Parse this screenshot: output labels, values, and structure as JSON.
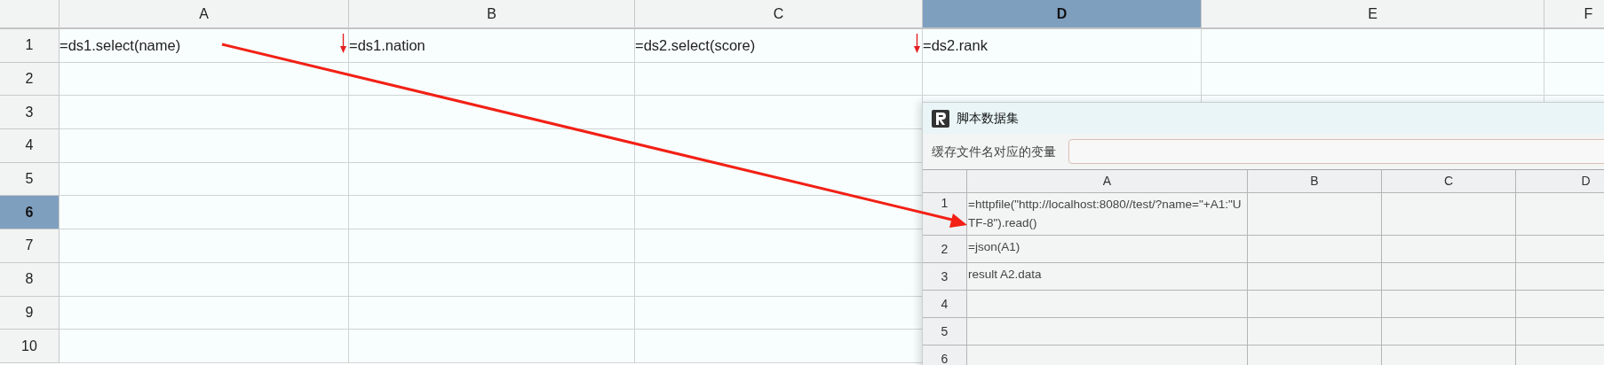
{
  "sheet": {
    "columns": [
      {
        "label": "A",
        "selected": false
      },
      {
        "label": "B",
        "selected": false
      },
      {
        "label": "C",
        "selected": false
      },
      {
        "label": "D",
        "selected": true
      },
      {
        "label": "E",
        "selected": false
      },
      {
        "label": "F",
        "selected": false
      }
    ],
    "rows": [
      {
        "label": "1",
        "selected": false,
        "cells": [
          {
            "text": "=ds1.select(name)",
            "expand_down": true
          },
          {
            "text": "=ds1.nation",
            "expand_down": false
          },
          {
            "text": "=ds2.select(score)",
            "expand_down": true
          },
          {
            "text": "=ds2.rank",
            "expand_down": false
          }
        ]
      },
      {
        "label": "2",
        "selected": false
      },
      {
        "label": "3",
        "selected": false
      },
      {
        "label": "4",
        "selected": false
      },
      {
        "label": "5",
        "selected": false
      },
      {
        "label": "6",
        "selected": true
      },
      {
        "label": "7",
        "selected": false
      },
      {
        "label": "8",
        "selected": false
      },
      {
        "label": "9",
        "selected": false
      },
      {
        "label": "10",
        "selected": false
      }
    ]
  },
  "dialog": {
    "title": "脚本数据集",
    "field_label": "缓存文件名对应的变量",
    "grid": {
      "columns": [
        "A",
        "B",
        "C",
        "D"
      ],
      "rows": [
        {
          "label": "1",
          "cells": [
            "=httpfile(\"http://localhost:8080//test/?name=\"+A1:\"UTF-8\").read()"
          ]
        },
        {
          "label": "2",
          "cells": [
            "=json(A1)"
          ]
        },
        {
          "label": "3",
          "cells": [
            "result A2.data"
          ]
        },
        {
          "label": "4"
        },
        {
          "label": "5"
        },
        {
          "label": "6"
        }
      ]
    }
  }
}
